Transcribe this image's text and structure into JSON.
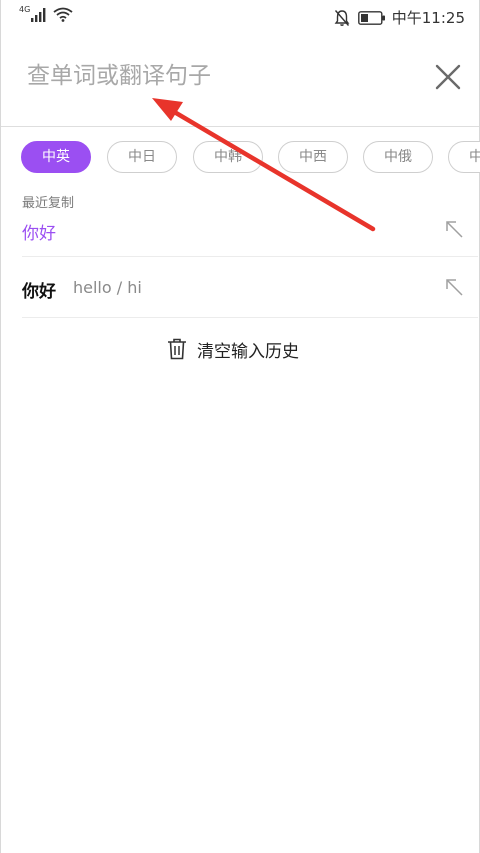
{
  "status_bar": {
    "network": "4G",
    "time": "中午11:25"
  },
  "search": {
    "placeholder": "查单词或翻译句子",
    "value": ""
  },
  "languages": [
    {
      "label": "中英",
      "active": true
    },
    {
      "label": "中日",
      "active": false
    },
    {
      "label": "中韩",
      "active": false
    },
    {
      "label": "中西",
      "active": false
    },
    {
      "label": "中俄",
      "active": false
    },
    {
      "label": "中",
      "active": false
    }
  ],
  "recent_copy": {
    "label": "最近复制",
    "text": "你好"
  },
  "history": [
    {
      "word": "你好",
      "meaning": "hello / hi"
    }
  ],
  "clear_history_label": "清空输入历史",
  "colors": {
    "accent": "#9b4ff2",
    "annotation_arrow": "#e8342b"
  }
}
